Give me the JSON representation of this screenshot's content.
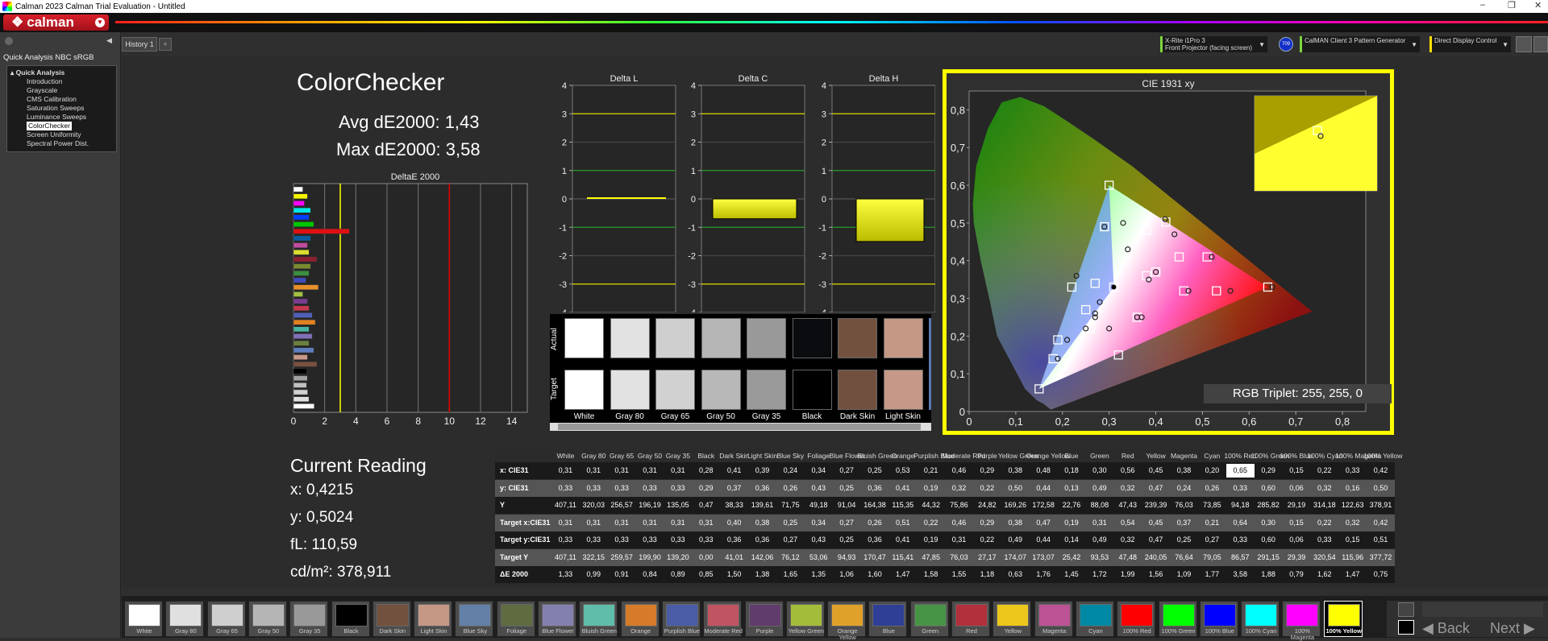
{
  "window": {
    "title": "Calman 2023 Calman Trial Evaluation - Untitled",
    "min": "–",
    "max": "❐",
    "close": "✕"
  },
  "brand": {
    "name": "calman"
  },
  "left_panel": {
    "header": "Quick Analysis NBC sRGB",
    "section": "Quick Analysis",
    "items": [
      "Introduction",
      "Grayscale",
      "CMS Calibration",
      "Saturation Sweeps",
      "Luminance Sweeps",
      "ColorChecker",
      "Screen Uniformity",
      "Spectral Power Dist."
    ],
    "selected": "ColorChecker"
  },
  "history_tab": "History 1",
  "controls": {
    "meter_line1": "X-Rite i1Pro 3",
    "meter_line2": "Front Projector (facing screen)",
    "meter_badge": "709",
    "generator": "CalMAN Client 3 Pattern Generator",
    "display": "Direct Display Control"
  },
  "page": {
    "title": "ColorChecker",
    "avg": "Avg dE2000: 1,43",
    "max": "Max dE2000: 3,58"
  },
  "deltae_chart": {
    "title": "DeltaE 2000",
    "ticks": [
      "0",
      "2",
      "4",
      "6",
      "8",
      "10",
      "12",
      "14"
    ],
    "bars": [
      {
        "v": 0.6,
        "c": "#ffffff"
      },
      {
        "v": 0.9,
        "c": "#f4f400"
      },
      {
        "v": 0.7,
        "c": "#ff00ff"
      },
      {
        "v": 1.1,
        "c": "#00e6e6"
      },
      {
        "v": 1.0,
        "c": "#0040ff"
      },
      {
        "v": 1.3,
        "c": "#00c800"
      },
      {
        "v": 3.58,
        "c": "#e01010"
      },
      {
        "v": 1.1,
        "c": "#0a5c9e"
      },
      {
        "v": 0.9,
        "c": "#c04ca0"
      },
      {
        "v": 1.0,
        "c": "#dcdc30"
      },
      {
        "v": 1.5,
        "c": "#8c2030"
      },
      {
        "v": 1.1,
        "c": "#7a8a30"
      },
      {
        "v": 1.0,
        "c": "#3a9040"
      },
      {
        "v": 0.8,
        "c": "#404cbc"
      },
      {
        "v": 1.6,
        "c": "#e8902a"
      },
      {
        "v": 0.6,
        "c": "#a0c040"
      },
      {
        "v": 0.9,
        "c": "#7a3c90"
      },
      {
        "v": 1.0,
        "c": "#c83850"
      },
      {
        "v": 1.2,
        "c": "#5060b8"
      },
      {
        "v": 1.4,
        "c": "#e08020"
      },
      {
        "v": 1.0,
        "c": "#48b4a0"
      },
      {
        "v": 1.2,
        "c": "#8070b8"
      },
      {
        "v": 1.0,
        "c": "#6a8040"
      },
      {
        "v": 1.3,
        "c": "#5e7ec0"
      },
      {
        "v": 0.9,
        "c": "#c89888"
      },
      {
        "v": 1.5,
        "c": "#7a5040"
      },
      {
        "v": 0.85,
        "c": "#000000"
      },
      {
        "v": 0.89,
        "c": "#a0a0a0"
      },
      {
        "v": 0.84,
        "c": "#c0c0c0"
      },
      {
        "v": 0.91,
        "c": "#d0d0d0"
      },
      {
        "v": 0.99,
        "c": "#e0e0e0"
      },
      {
        "v": 1.33,
        "c": "#ffffff"
      }
    ],
    "yellow_line": 3,
    "red_line": 10
  },
  "delta_charts": [
    {
      "title": "Delta L",
      "ticks": [
        "4",
        "3",
        "2",
        "1",
        "0",
        "-1",
        "-2",
        "-3",
        "-4"
      ],
      "bar": 0.05,
      "type": "line"
    },
    {
      "title": "Delta C",
      "ticks": [
        "4",
        "3",
        "2",
        "1",
        "0",
        "-1",
        "-2",
        "-3",
        "-4"
      ],
      "bar": -0.7,
      "type": "bar"
    },
    {
      "title": "Delta H",
      "ticks": [
        "4",
        "3",
        "2",
        "1",
        "0",
        "-1",
        "-2",
        "-3",
        "-4"
      ],
      "bar": -1.5,
      "type": "bar"
    }
  ],
  "swatches_panel": {
    "actual_label": "Actual",
    "target_label": "Target",
    "items": [
      {
        "name": "White",
        "actual": "#ffffff",
        "target": "#ffffff"
      },
      {
        "name": "Gray 80",
        "actual": "#e2e2e2",
        "target": "#e2e2e2"
      },
      {
        "name": "Gray 65",
        "actual": "#cfcfcf",
        "target": "#d1d1d1"
      },
      {
        "name": "Gray 50",
        "actual": "#b6b6b6",
        "target": "#b8b8b8"
      },
      {
        "name": "Gray 35",
        "actual": "#999999",
        "target": "#9a9a9a"
      },
      {
        "name": "Black",
        "actual": "#0a0c10",
        "target": "#000000"
      },
      {
        "name": "Dark Skin",
        "actual": "#73513f",
        "target": "#72503f"
      },
      {
        "name": "Light Skin",
        "actual": "#c59886",
        "target": "#c59887"
      }
    ]
  },
  "cie": {
    "title": "CIE 1931 xy",
    "xticks": [
      "0",
      "0,1",
      "0,2",
      "0,3",
      "0,4",
      "0,5",
      "0,6",
      "0,7",
      "0,8"
    ],
    "yticks": [
      "0,8",
      "0,7",
      "0,6",
      "0,5",
      "0,4",
      "0,3",
      "0,2",
      "0,1",
      "0"
    ],
    "targets": [
      [
        0.64,
        0.33
      ],
      [
        0.3,
        0.6
      ],
      [
        0.15,
        0.06
      ],
      [
        0.4215,
        0.5024
      ],
      [
        0.22,
        0.33
      ],
      [
        0.32,
        0.15
      ],
      [
        0.45,
        0.41
      ],
      [
        0.38,
        0.36
      ],
      [
        0.25,
        0.27
      ],
      [
        0.27,
        0.34
      ],
      [
        0.18,
        0.14
      ],
      [
        0.53,
        0.32
      ],
      [
        0.29,
        0.49
      ],
      [
        0.31,
        0.33
      ],
      [
        0.46,
        0.32
      ],
      [
        0.51,
        0.41
      ],
      [
        0.38,
        0.48
      ],
      [
        0.36,
        0.25
      ],
      [
        0.26,
        0.22
      ],
      [
        0.19,
        0.19
      ],
      [
        0.4,
        0.37
      ]
    ],
    "actuals": [
      [
        0.65,
        0.33
      ],
      [
        0.29,
        0.49
      ],
      [
        0.33,
        0.5
      ],
      [
        0.44,
        0.47
      ],
      [
        0.23,
        0.36
      ],
      [
        0.27,
        0.26
      ],
      [
        0.56,
        0.32
      ],
      [
        0.47,
        0.32
      ],
      [
        0.52,
        0.41
      ],
      [
        0.4,
        0.37
      ],
      [
        0.385,
        0.35
      ],
      [
        0.37,
        0.25
      ],
      [
        0.34,
        0.43
      ],
      [
        0.21,
        0.19
      ],
      [
        0.25,
        0.22
      ],
      [
        0.27,
        0.25
      ],
      [
        0.19,
        0.14
      ],
      [
        0.28,
        0.29
      ],
      [
        0.42,
        0.51
      ],
      [
        0.3,
        0.22
      ],
      [
        0.36,
        0.25
      ]
    ],
    "current": [
      0.31,
      0.33
    ],
    "triplet": "RGB Triplet: 255, 255, 0"
  },
  "current_reading": {
    "title": "Current Reading",
    "x": "x: 0,4215",
    "y": "y: 0,5024",
    "fL": "fL: 110,59",
    "cd": "cd/m²: 378,911"
  },
  "table": {
    "columns": [
      "White",
      "Gray 80",
      "Gray 65",
      "Gray 50",
      "Gray 35",
      "Black",
      "Dark Skin",
      "Light Skin",
      "Blue Sky",
      "Foliage",
      "Blue Flower",
      "Bluish Green",
      "Orange",
      "Purplish Blue",
      "Moderate Red",
      "Purple",
      "Yellow Green",
      "Orange Yellow",
      "Blue",
      "Green",
      "Red",
      "Yellow",
      "Magenta",
      "Cyan",
      "100% Red",
      "100% Green",
      "100% Blue",
      "100% Cyan",
      "100% Magenta",
      "100% Yellow"
    ],
    "rows": [
      {
        "label": "x: CIE31",
        "cells": [
          "0,31",
          "0,31",
          "0,31",
          "0,31",
          "0,31",
          "0,28",
          "0,41",
          "0,39",
          "0,24",
          "0,34",
          "0,27",
          "0,25",
          "0,53",
          "0,21",
          "0,46",
          "0,29",
          "0,38",
          "0,48",
          "0,18",
          "0,30",
          "0,56",
          "0,45",
          "0,38",
          "0,20",
          "0,65",
          "0,29",
          "0,15",
          "0,22",
          "0,33",
          "0,42"
        ]
      },
      {
        "label": "y: CIE31",
        "cells": [
          "0,33",
          "0,33",
          "0,33",
          "0,33",
          "0,33",
          "0,29",
          "0,37",
          "0,36",
          "0,26",
          "0,43",
          "0,25",
          "0,36",
          "0,41",
          "0,19",
          "0,32",
          "0,22",
          "0,50",
          "0,44",
          "0,13",
          "0,49",
          "0,32",
          "0,47",
          "0,24",
          "0,26",
          "0,33",
          "0,60",
          "0,06",
          "0,32",
          "0,16",
          "0,50"
        ]
      },
      {
        "label": "Y",
        "cells": [
          "407,11",
          "320,03",
          "256,57",
          "196,19",
          "135,05",
          "0,47",
          "38,33",
          "139,61",
          "71,75",
          "49,18",
          "91,04",
          "164,38",
          "115,35",
          "44,32",
          "75,86",
          "24,82",
          "169,26",
          "172,58",
          "22,76",
          "88,08",
          "47,43",
          "239,39",
          "76,03",
          "73,85",
          "94,18",
          "285,82",
          "29,19",
          "314,18",
          "122,63",
          "378,91"
        ]
      },
      {
        "label": "Target x:CIE31",
        "cells": [
          "0,31",
          "0,31",
          "0,31",
          "0,31",
          "0,31",
          "0,31",
          "0,40",
          "0,38",
          "0,25",
          "0,34",
          "0,27",
          "0,26",
          "0,51",
          "0,22",
          "0,46",
          "0,29",
          "0,38",
          "0,47",
          "0,19",
          "0,31",
          "0,54",
          "0,45",
          "0,37",
          "0,21",
          "0,64",
          "0,30",
          "0,15",
          "0,22",
          "0,32",
          "0,42"
        ]
      },
      {
        "label": "Target y:CIE31",
        "cells": [
          "0,33",
          "0,33",
          "0,33",
          "0,33",
          "0,33",
          "0,33",
          "0,36",
          "0,36",
          "0,27",
          "0,43",
          "0,25",
          "0,36",
          "0,41",
          "0,19",
          "0,31",
          "0,22",
          "0,49",
          "0,44",
          "0,14",
          "0,49",
          "0,32",
          "0,47",
          "0,25",
          "0,27",
          "0,33",
          "0,60",
          "0,06",
          "0,33",
          "0,15",
          "0,51"
        ]
      },
      {
        "label": "Target Y",
        "cells": [
          "407,11",
          "322,15",
          "259,57",
          "199,90",
          "139,20",
          "0,00",
          "41,01",
          "142,06",
          "76,12",
          "53,06",
          "94,93",
          "170,47",
          "115,41",
          "47,85",
          "76,03",
          "27,17",
          "174,07",
          "173,07",
          "25,42",
          "93,53",
          "47,48",
          "240,05",
          "76,64",
          "79,05",
          "86,57",
          "291,15",
          "29,39",
          "320,54",
          "115,96",
          "377,72"
        ]
      },
      {
        "label": "ΔE 2000",
        "cells": [
          "1,33",
          "0,99",
          "0,91",
          "0,84",
          "0,89",
          "0,85",
          "1,50",
          "1,38",
          "1,65",
          "1,35",
          "1,06",
          "1,60",
          "1,47",
          "1,58",
          "1,55",
          "1,18",
          "0,63",
          "1,76",
          "1,45",
          "1,72",
          "1,99",
          "1,56",
          "1,09",
          "1,77",
          "3,58",
          "1,88",
          "0,79",
          "1,62",
          "1,47",
          "0,75"
        ]
      }
    ],
    "highlight": "0,65"
  },
  "footer": {
    "swatches": [
      {
        "n": "White",
        "c": "#ffffff"
      },
      {
        "n": "Gray 80",
        "c": "#e0e0e0"
      },
      {
        "n": "Gray 65",
        "c": "#cfcfcf"
      },
      {
        "n": "Gray 50",
        "c": "#b5b5b5"
      },
      {
        "n": "Gray 35",
        "c": "#999999"
      },
      {
        "n": "Black",
        "c": "#000000"
      },
      {
        "n": "Dark Skin",
        "c": "#73513f"
      },
      {
        "n": "Light Skin",
        "c": "#c59886"
      },
      {
        "n": "Blue Sky",
        "c": "#6380a6"
      },
      {
        "n": "Foliage",
        "c": "#5e6c40"
      },
      {
        "n": "Blue Flower",
        "c": "#8480ae"
      },
      {
        "n": "Bluish Green",
        "c": "#5fbda9"
      },
      {
        "n": "Orange",
        "c": "#d57b2a"
      },
      {
        "n": "Purplish Blue",
        "c": "#4a5ca6"
      },
      {
        "n": "Moderate Red",
        "c": "#c05462"
      },
      {
        "n": "Purple",
        "c": "#5f3c6b"
      },
      {
        "n": "Yellow Green",
        "c": "#a3bd3a"
      },
      {
        "n": "Orange Yellow",
        "c": "#e0a12a"
      },
      {
        "n": "Blue",
        "c": "#2f3f96"
      },
      {
        "n": "Green",
        "c": "#489447"
      },
      {
        "n": "Red",
        "c": "#b2303b"
      },
      {
        "n": "Yellow",
        "c": "#ecc71c"
      },
      {
        "n": "Magenta",
        "c": "#bb5394"
      },
      {
        "n": "Cyan",
        "c": "#0089a4"
      },
      {
        "n": "100% Red",
        "c": "#ff0000"
      },
      {
        "n": "100% Green",
        "c": "#00ff00"
      },
      {
        "n": "100% Blue",
        "c": "#0000ff"
      },
      {
        "n": "100% Cyan",
        "c": "#00ffff"
      },
      {
        "n": "100% Magenta",
        "c": "#ff00ff"
      },
      {
        "n": "100% Yellow",
        "c": "#ffff00"
      }
    ],
    "selected": "100% Yellow",
    "back": "◀ Back",
    "next": "Next ▶"
  },
  "colors": {
    "accent_yellow": "#ffff00",
    "brand_red": "#c8141e",
    "control_green": "#7dd63e"
  }
}
